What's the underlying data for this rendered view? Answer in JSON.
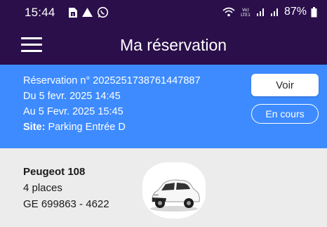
{
  "status_bar": {
    "time": "15:44",
    "battery": "87%",
    "volte": "Vo)\nLTE1"
  },
  "app_bar": {
    "title": "Ma réservation"
  },
  "booking": {
    "reservation_line": "Réservation n° 2025251738761447887",
    "from_line": "Du 5 fevr. 2025 14:45",
    "to_line": "Au 5 Fevr. 2025 15:45",
    "site_label": "Site:",
    "site_value": " Parking Entrée D",
    "voir_label": "Voir",
    "status_label": "En cours"
  },
  "vehicle": {
    "model": "Peugeot  108",
    "places": "4  places",
    "plate": "GE 699863 - 4622"
  },
  "colors": {
    "app_bar_bg": "#2a0f4a",
    "booking_bg": "#3d8bff",
    "vehicle_bg": "#ececec"
  }
}
